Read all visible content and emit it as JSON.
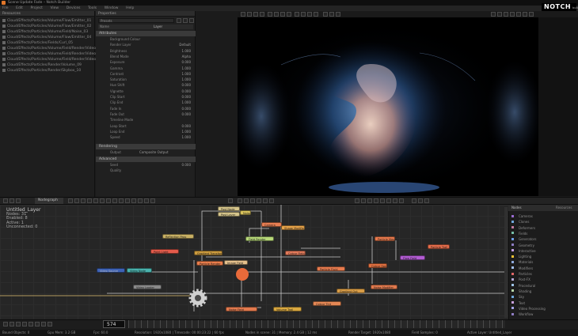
{
  "window": {
    "title": "Scene Update Fade – Notch Builder"
  },
  "menubar": {
    "items": [
      "File",
      "Edit",
      "Project",
      "View",
      "Devices",
      "Tools",
      "Window",
      "Help"
    ]
  },
  "logo": {
    "text": "NOTCH",
    "sub": "builder"
  },
  "resources": {
    "title": "Resources",
    "items": [
      "Cloud/Effects/Particles/Volume/Flow/Emitter_01",
      "Cloud/Effects/Particles/Volume/Flow/Emitter_02",
      "Cloud/Effects/Particles/Volume/Field/Noise_03",
      "Cloud/Effects/Particles/Volume/Flow/Emitter_04",
      "Cloud/Effects/Particles/Fields/Curl_05",
      "Cloud/Effects/Particles/Volume/Field/Render/Video_06",
      "Cloud/Effects/Particles/Volume/Field/Render/Video_07",
      "Cloud/Effects/Particles/Volume/Field/Render/Video_08",
      "Cloud/Effects/Particles/Render/Volume_09",
      "Cloud/Effects/Particles/Render/Skybox_10"
    ]
  },
  "properties": {
    "title": "Properties",
    "preset": "Presets",
    "name_label": "Name",
    "name_value": "Layer",
    "section_main": "Attributes",
    "rows": [
      {
        "label": "Background Colour",
        "value": ""
      },
      {
        "label": "Render Layer",
        "value": "Default"
      },
      {
        "label": "Brightness",
        "value": "1.000"
      },
      {
        "label": "Blend Mode",
        "value": "Alpha"
      },
      {
        "label": "Exposure",
        "value": "0.000"
      },
      {
        "label": "Gamma",
        "value": "1.000"
      },
      {
        "label": "Contrast",
        "value": "1.000"
      },
      {
        "label": "Saturation",
        "value": "1.000"
      },
      {
        "label": "Hue Shift",
        "value": "0.000"
      },
      {
        "label": "Vignette",
        "value": "0.000"
      },
      {
        "label": "Clip Start",
        "value": "0.000"
      },
      {
        "label": "Clip End",
        "value": "1.000"
      },
      {
        "label": "Fade In",
        "value": "0.000"
      },
      {
        "label": "Fade Out",
        "value": "0.000"
      },
      {
        "label": "Timeline Mode",
        "value": ""
      },
      {
        "label": "Loop Start",
        "value": "0.000"
      },
      {
        "label": "Loop End",
        "value": "1.000"
      },
      {
        "label": "Speed",
        "value": "1.000"
      }
    ],
    "section_2": "Rendering",
    "row_2": {
      "label": "Output",
      "value": "Composite Output"
    },
    "section_3": "Advanced",
    "rows_3": [
      {
        "label": "Seed",
        "value": "0.000"
      },
      {
        "label": "Quality",
        "value": ""
      }
    ]
  },
  "nodegraph": {
    "tab": "Nodegraph",
    "layer_title": "Untitled_Layer",
    "layer_lines": [
      "Nodes: 31",
      "Enabled: 8",
      "Active: 1",
      "Unconnected: 0"
    ],
    "nodes": [
      {
        "label": "Post Node",
        "color": "#d5c48a",
        "kind": "light"
      },
      {
        "label": "Post Layer",
        "color": "#d5c48a",
        "kind": "light"
      },
      {
        "label": "Noise Trans",
        "color": "#d9c35c",
        "kind": "light"
      },
      {
        "label": "Camera",
        "color": "#e77e52",
        "kind": "light"
      },
      {
        "label": "Reflection Pass",
        "color": "#c8b064",
        "kind": "light"
      },
      {
        "label": "Field Render",
        "color": "#b8d97a",
        "kind": "light"
      },
      {
        "label": "Shape Modifier",
        "color": "#e8a44a",
        "kind": "light"
      },
      {
        "label": "Gradient Transform",
        "color": "#cc9b3e",
        "kind": "light"
      },
      {
        "label": "Colour Field",
        "color": "#e27a5a",
        "kind": "light"
      },
      {
        "label": "Particle Root",
        "color": "#e87e40",
        "kind": "light"
      },
      {
        "label": "Point Light",
        "color": "#e35b4b",
        "kind": "light"
      },
      {
        "label": "Image Field",
        "color": "#e4c08c",
        "kind": "light"
      },
      {
        "label": "Particle Render",
        "color": "#e97d4b",
        "kind": "light"
      },
      {
        "label": "Particle Emitter",
        "color": "#e0793e",
        "kind": "light"
      },
      {
        "label": "Velocity Affector",
        "color": "#b83a2c",
        "kind": "dark"
      },
      {
        "label": "Flow Field",
        "color": "#b25cd2",
        "kind": "light"
      },
      {
        "label": "Particle Fluid",
        "color": "#e77b4e",
        "kind": "light"
      },
      {
        "label": "Colour Spread",
        "color": "#e07040",
        "kind": "light"
      },
      {
        "label": "Video Source",
        "color": "#3e62b5",
        "kind": "dark"
      },
      {
        "label": "Video Node",
        "color": "#4ab2ad",
        "kind": "light"
      },
      {
        "label": "Video Loader",
        "color": "#8a8a8a",
        "kind": "light"
      },
      {
        "label": "Depth Cam",
        "color": "#4a7a9a",
        "kind": "dark"
      },
      {
        "label": "Gradient Out",
        "color": "#d89c46",
        "kind": "light"
      },
      {
        "label": "Noise Modifier",
        "color": "#e27a4e",
        "kind": "light"
      },
      {
        "label": "Emitter Mesh",
        "color": "#d9a840",
        "kind": "light"
      },
      {
        "label": "Particle Mesh",
        "color": "#e87a4d",
        "kind": "light"
      },
      {
        "label": "Particle Trail",
        "color": "#e56d4b",
        "kind": "light"
      },
      {
        "label": "Particle Root 2",
        "color": "#e87e40",
        "kind": "light"
      },
      {
        "label": "Noise Field",
        "color": "#e27a4e",
        "kind": "light"
      },
      {
        "label": "Colour Tint",
        "color": "#e58855",
        "kind": "light"
      },
      {
        "label": "Volume Trail",
        "color": "#d9a840",
        "kind": "light"
      }
    ]
  },
  "library": {
    "tabs": [
      "Nodes",
      "Resources"
    ],
    "items": [
      {
        "label": "Cameras",
        "color": "#9b6bd3"
      },
      {
        "label": "Clones",
        "color": "#6fa8dc"
      },
      {
        "label": "Deformers",
        "color": "#c27ba0"
      },
      {
        "label": "Fields",
        "color": "#76c0a8"
      },
      {
        "label": "Generators",
        "color": "#6d9eeb"
      },
      {
        "label": "Geometry",
        "color": "#8e7cc3"
      },
      {
        "label": "Interactive",
        "color": "#c4a0e8"
      },
      {
        "label": "Lighting",
        "color": "#f1c232"
      },
      {
        "label": "Materials",
        "color": "#8faadc"
      },
      {
        "label": "Modifiers",
        "color": "#a4c2f4"
      },
      {
        "label": "Particles",
        "color": "#e06666"
      },
      {
        "label": "Post-FX",
        "color": "#b4a7d6"
      },
      {
        "label": "Procedural",
        "color": "#9fc5e8"
      },
      {
        "label": "Shading",
        "color": "#b6d7a8"
      },
      {
        "label": "Sky",
        "color": "#6fa8dc"
      },
      {
        "label": "Text",
        "color": "#c9a0dc"
      },
      {
        "label": "Video Processing",
        "color": "#a4a4e8"
      },
      {
        "label": "Workflow",
        "color": "#8e7cc3"
      }
    ]
  },
  "timeline": {
    "frame": "574"
  },
  "statusbar": {
    "items": [
      "Bound Objects: 0",
      "Gpu Mem: 3.2 GB",
      "Fps: 60.0",
      "Resolution: 1920x1080 | Timecode: 00:00:23:22 | 60 fps",
      "Nodes in scene: 31 | Memory: 2.4 GB | 12 ms",
      "Render Target: 1920x1080",
      "Field Samples: 0",
      "Active Layer: Untitled_Layer"
    ]
  }
}
